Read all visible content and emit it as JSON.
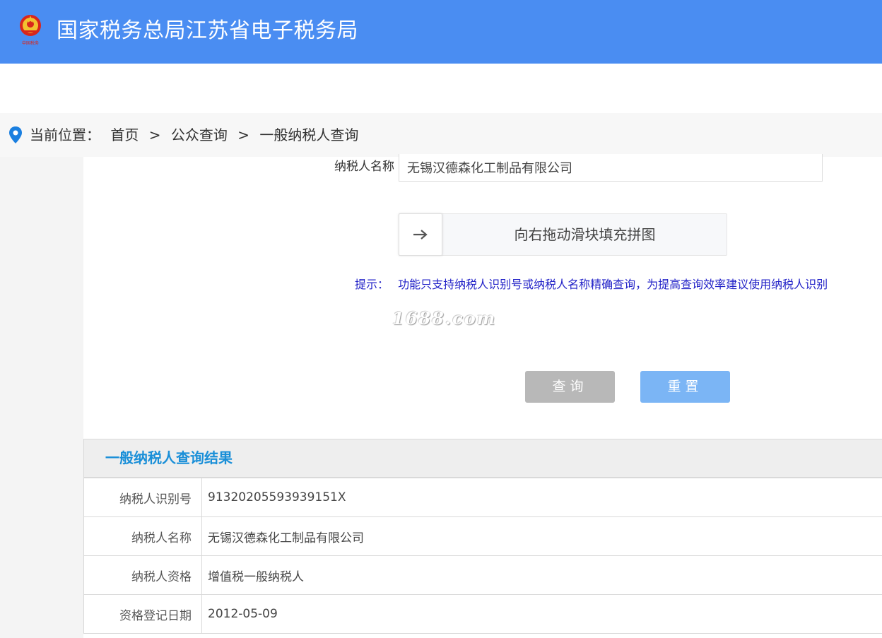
{
  "header": {
    "site_title": "国家税务总局江苏省电子税务局",
    "brand_color": "#4a8df2",
    "emblem_icon": "tax-emblem-icon"
  },
  "breadcrumb": {
    "location_label": "当前位置：",
    "items": [
      "首页",
      "公众查询",
      "一般纳税人查询"
    ],
    "separator": ">"
  },
  "form": {
    "name_label": "纳税人名称",
    "name_value": "无锡汉德森化工制品有限公司",
    "slider_text": "向右拖动滑块填充拼图",
    "slider_icon": "arrow-right-icon",
    "tip_label": "提示：",
    "tip_text": "功能只支持纳税人识别号或纳税人名称精确查询，为提高查询效率建议使用纳税人识别",
    "query_button": "查询",
    "reset_button": "重置"
  },
  "watermark": "1688.com",
  "result": {
    "title": "一般纳税人查询结果",
    "rows": [
      {
        "label": "纳税人识别号",
        "value": "91320205593939151X"
      },
      {
        "label": "纳税人名称",
        "value": "无锡汉德森化工制品有限公司"
      },
      {
        "label": "纳税人资格",
        "value": "增值税一般纳税人"
      },
      {
        "label": "资格登记日期",
        "value": "2012-05-09"
      }
    ]
  },
  "colors": {
    "tip": "#2323c8",
    "result_title": "#1a8fd8",
    "query_button": "#b8b8b8",
    "reset_button": "#7bb5f5"
  }
}
